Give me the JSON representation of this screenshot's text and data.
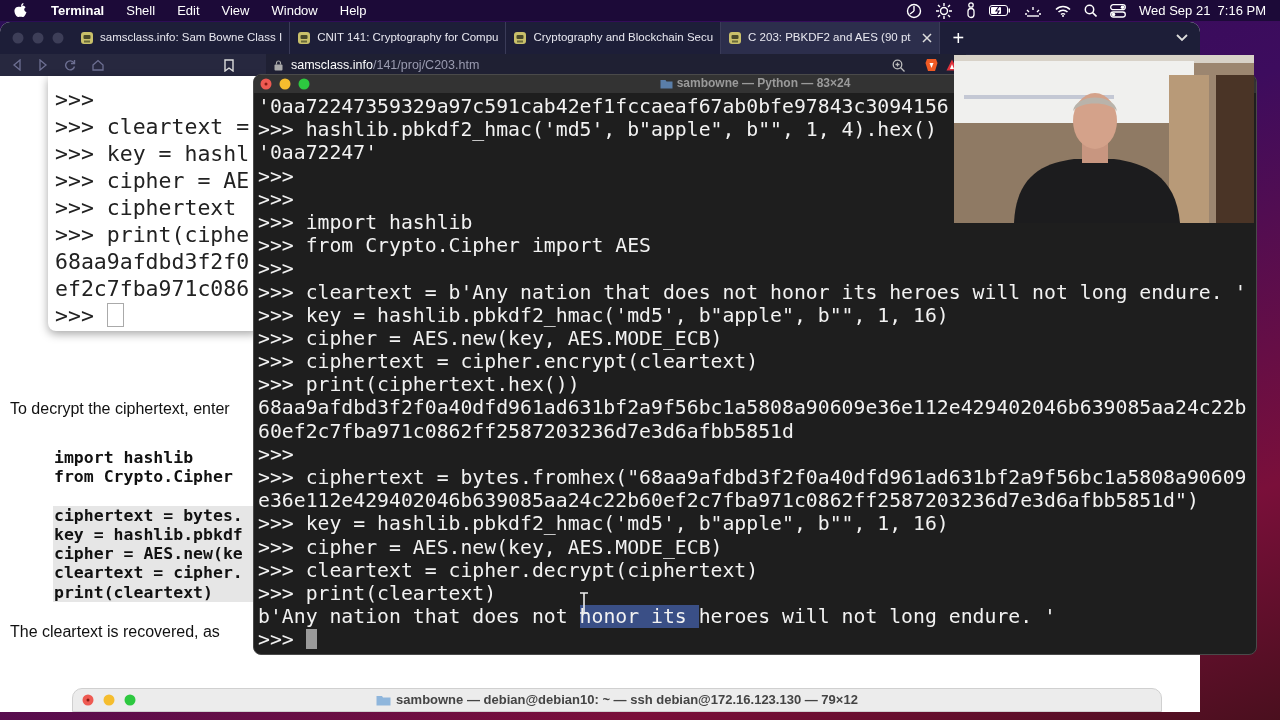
{
  "menu_bar": {
    "app": "Terminal",
    "menus": [
      "Shell",
      "Edit",
      "View",
      "Window",
      "Help"
    ],
    "clock": "Wed Sep 21  7:16 PM"
  },
  "browser": {
    "tabs": [
      {
        "title": "samsclass.info: Sam Bowne Class I",
        "selected": false
      },
      {
        "title": "CNIT 141: Cryptography for Compu",
        "selected": false
      },
      {
        "title": "Cryptography and Blockchain Secu",
        "selected": false
      },
      {
        "title": "C 203: PBKDF2 and AES (90 pt",
        "selected": true
      }
    ],
    "new_tab": "+",
    "url_host": "samsclass.info",
    "url_path": "/141/proj/C203.htm",
    "page": {
      "screenshot_lines": [
        {
          "text": ">>>"
        },
        {
          "text": ">>> cleartext ="
        },
        {
          "text": ">>> key = hashl"
        },
        {
          "text": ">>> cipher = AE"
        },
        {
          "text": ">>> ciphertext"
        },
        {
          "text": ">>> print(ciphe"
        },
        {
          "text": "68aa9afdbd3f2f0"
        },
        {
          "text": "ef2c7fba971c086"
        },
        {
          "text": ">>> ",
          "cursor": true
        }
      ],
      "paragraph_1": "To decrypt the ciphertext, enter",
      "code_blocks": [
        {
          "lines": [
            {
              "text": "import hashlib",
              "highlighted": false
            },
            {
              "text": "from Crypto.Cipher",
              "highlighted": false
            }
          ]
        },
        {
          "lines": [
            {
              "text": "ciphertext = bytes.",
              "highlighted": true
            },
            {
              "text": "key = hashlib.pbkdf",
              "highlighted": true
            },
            {
              "text": "cipher = AES.new(ke",
              "highlighted": true
            },
            {
              "text": "cleartext = cipher.",
              "highlighted": true
            },
            {
              "text": "print(cleartext)",
              "highlighted": true
            }
          ]
        }
      ],
      "paragraph_2": "The cleartext is recovered, as"
    }
  },
  "terminal": {
    "title": "sambowne — Python — 83×24",
    "lines": [
      {
        "text": "'0aa72247359329a97c591cab42ef1fccaeaf67ab0bfe97843c3094156"
      },
      {
        "text": ">>> hashlib.pbkdf2_hmac('md5', b\"apple\", b\"\", 1, 4).hex()"
      },
      {
        "text": "'0aa72247'"
      },
      {
        "text": ">>>"
      },
      {
        "text": ">>>"
      },
      {
        "text": ">>> import hashlib"
      },
      {
        "text": ">>> from Crypto.Cipher import AES"
      },
      {
        "text": ">>>"
      },
      {
        "text": ">>> cleartext = b'Any nation that does not honor its heroes will not long endure. '"
      },
      {
        "text": ">>> key = hashlib.pbkdf2_hmac('md5', b\"apple\", b\"\", 1, 16)"
      },
      {
        "text": ">>> cipher = AES.new(key, AES.MODE_ECB)"
      },
      {
        "text": ">>> ciphertext = cipher.encrypt(cleartext)"
      },
      {
        "text": ">>> print(ciphertext.hex())"
      },
      {
        "text": "68aa9afdbd3f2f0a40dfd961ad631bf2a9f56bc1a5808a90609e36e112e429402046b639085aa24c22b"
      },
      {
        "text": "60ef2c7fba971c0862ff2587203236d7e3d6afbb5851d"
      },
      {
        "text": ">>>"
      },
      {
        "text": ">>> ciphertext = bytes.fromhex(\"68aa9afdbd3f2f0a40dfd961ad631bf2a9f56bc1a5808a90609"
      },
      {
        "text": "e36e112e429402046b639085aa24c22b60ef2c7fba971c0862ff2587203236d7e3d6afbb5851d\")"
      },
      {
        "text": ">>> key = hashlib.pbkdf2_hmac('md5', b\"apple\", b\"\", 1, 16)"
      },
      {
        "text": ">>> cipher = AES.new(key, AES.MODE_ECB)"
      },
      {
        "text": ">>> cleartext = cipher.decrypt(ciphertext)"
      },
      {
        "text": ">>> print(cleartext)"
      },
      {
        "segments": [
          {
            "text": "b'Any nation that does not ",
            "selected": false
          },
          {
            "text": "honor its ",
            "selected": true
          },
          {
            "text": "heroes will not long endure. '",
            "selected": false
          }
        ]
      },
      {
        "text": ">>> ",
        "cursor": true
      }
    ]
  },
  "background_terminal": {
    "title": "sambowne — debian@debian10: ~ — ssh debian@172.16.123.130 — 79×12"
  }
}
